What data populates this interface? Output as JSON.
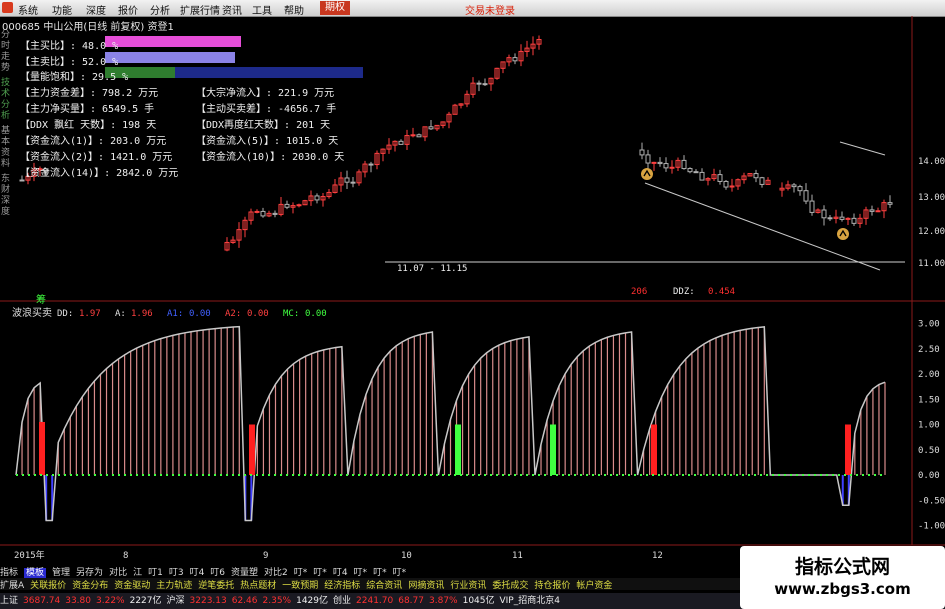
{
  "menubar": {
    "items": [
      "系统",
      "功能",
      "深度",
      "报价",
      "分析",
      "扩展行情",
      "资讯",
      "工具",
      "帮助"
    ],
    "active": "期权",
    "right": "交易未登录"
  },
  "stock": {
    "line": "000685 中山公用(日线 前复权) 资登1"
  },
  "vtabs": [
    "分时走势",
    "技术分析",
    "基本资料",
    "东财深度"
  ],
  "info": {
    "l1": "【主买比】: 48.0 %",
    "l2": "【主卖比】: 52.0 %",
    "l3": "【量能饱和】: 29.5 %",
    "l4": "【主力资金差】: 798.2 万元",
    "l5": "【主力净买量】: 6549.5 手",
    "l6": "【DDX 飘红 天数】: 198 天",
    "l7": "【资金流入(1)】: 203.0 万元",
    "l8": "【资金流入(2)】: 1421.0 万元",
    "l9": "【资金流入(14)】: 2842.0 万元",
    "r4": "【大宗净流入】: 221.9 万元",
    "r5": "【主动买卖差】: -4656.7 手",
    "r6": "【DDX再度红天数】: 201 天",
    "r7": "【资金流入(5)】: 1015.0 天",
    "r8": "【资金流入(10)】: 2030.0 天"
  },
  "main": {
    "range_label": "11.07 - 11.15",
    "ddz_red": "206",
    "ddz_label": "DDZ:",
    "ddz_val": "0.454",
    "yaxis": [
      "14.00",
      "13.00",
      "12.00",
      "11.00"
    ]
  },
  "indicator": {
    "tag": "筹",
    "title": "波浪买卖",
    "legend": [
      {
        "k": "DD:",
        "v": "1.97",
        "c": "#e0e0e0",
        "vc": "#ff4040"
      },
      {
        "k": "A:",
        "v": "1.96",
        "c": "#e0e0e0",
        "vc": "#ff4040"
      },
      {
        "k": "A1:",
        "v": "0.00",
        "c": "#4060ff",
        "vc": "#4060ff"
      },
      {
        "k": "A2:",
        "v": "0.00",
        "c": "#ff4040",
        "vc": "#ff4040"
      },
      {
        "k": "MC:",
        "v": "0.00",
        "c": "#40ff40",
        "vc": "#40ff40"
      }
    ],
    "yaxis": [
      "3.00",
      "2.50",
      "2.00",
      "1.50",
      "1.00",
      "0.50",
      "0.00",
      "-0.50",
      "-1.00"
    ]
  },
  "timeaxis": [
    "2015年",
    "8",
    "9",
    "10",
    "11",
    "12"
  ],
  "tabs1": [
    "指标",
    "模板",
    "管理",
    "另存为",
    "对比",
    "江",
    "叮1",
    "叮3",
    "叮4",
    "叮6",
    "资量塑",
    "对比2",
    "叮*",
    "叮*",
    "叮4",
    "叮*",
    "叮*",
    "叮*"
  ],
  "tabs2": [
    "扩展A",
    "关联报价",
    "资金分布",
    "资金驱动",
    "主力轨迹",
    "逆笔委托",
    "热点题材",
    "一致预期",
    "经济指标",
    "综合资讯",
    "网摘资讯",
    "行业资讯",
    "委托成交",
    "持仓报价",
    "帐户资金"
  ],
  "status": {
    "items": [
      {
        "t": "上证",
        "c": "white"
      },
      {
        "t": "3687.74",
        "c": "red"
      },
      {
        "t": "33.80",
        "c": "red"
      },
      {
        "t": "3.22%",
        "c": "red"
      },
      {
        "t": "2227亿",
        "c": "white"
      },
      {
        "t": "沪深",
        "c": "white"
      },
      {
        "t": "3223.13",
        "c": "red"
      },
      {
        "t": "62.46",
        "c": "red"
      },
      {
        "t": "2.35%",
        "c": "red"
      },
      {
        "t": "1429亿",
        "c": "white"
      },
      {
        "t": "创业",
        "c": "white"
      },
      {
        "t": "2241.70",
        "c": "red"
      },
      {
        "t": "68.77",
        "c": "red"
      },
      {
        "t": "3.87%",
        "c": "red"
      },
      {
        "t": "1045亿",
        "c": "white"
      },
      {
        "t": "VIP_招商北京4",
        "c": "white"
      }
    ]
  },
  "watermark": {
    "title": "指标公式网",
    "url": "www.zbgs3.com"
  },
  "colors": {
    "up": "#ff4040",
    "down": "#3cb4c8",
    "pink": "#d98c8c",
    "grey": "#b0b0b0",
    "green": "#40ff40",
    "blue": "#4040ff"
  }
}
